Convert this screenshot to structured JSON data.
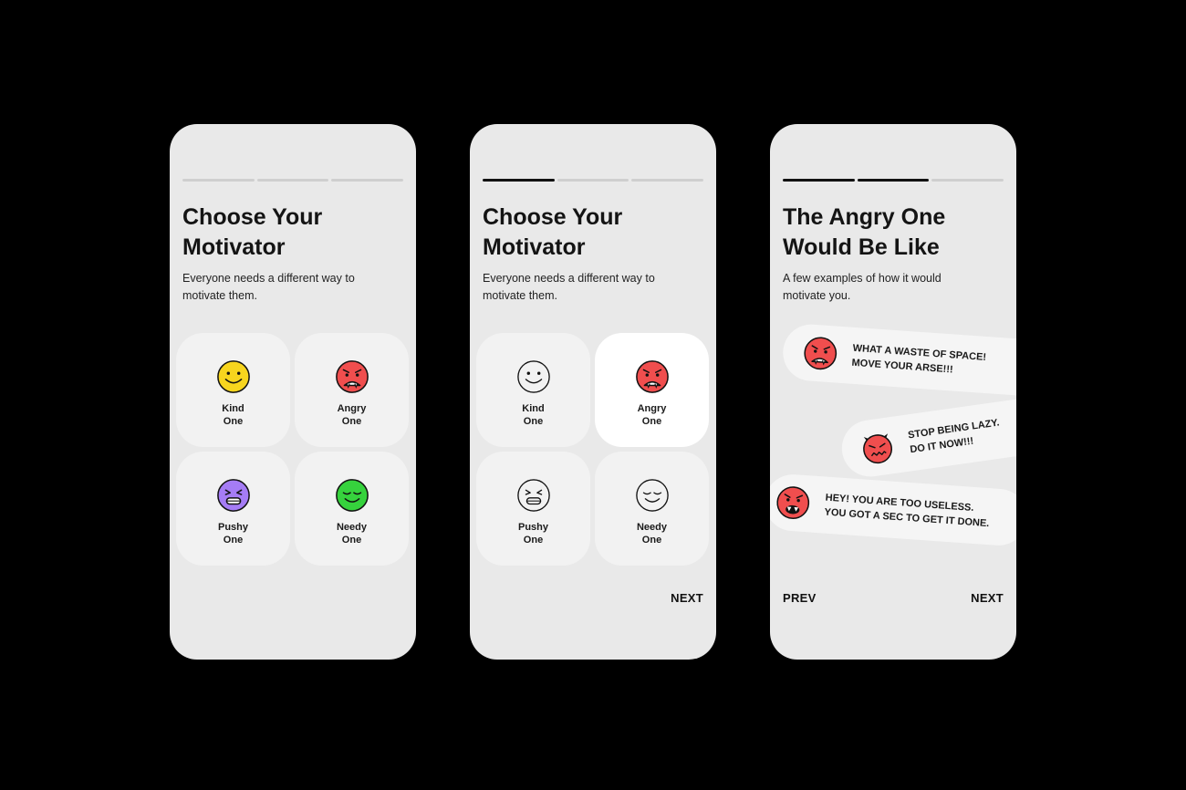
{
  "colors": {
    "kind": "#f7d51e",
    "angry": "#f04e4e",
    "pushy": "#a57cf5",
    "needy": "#36d23d",
    "outline": "#111111"
  },
  "screen1": {
    "title": "Choose Your\nMotivator",
    "subtitle": "Everyone needs a different way to motivate them.",
    "options": [
      {
        "label": "Kind\nOne",
        "icon": "smiling-face-icon"
      },
      {
        "label": "Angry\nOne",
        "icon": "angry-fanged-face-icon"
      },
      {
        "label": "Pushy\nOne",
        "icon": "gritting-face-icon"
      },
      {
        "label": "Needy\nOne",
        "icon": "content-face-icon"
      }
    ]
  },
  "screen2": {
    "title": "Choose Your\nMotivator",
    "subtitle": "Everyone needs a different way to motivate them.",
    "selected": "Angry One",
    "options": [
      {
        "label": "Kind\nOne"
      },
      {
        "label": "Angry\nOne"
      },
      {
        "label": "Pushy\nOne"
      },
      {
        "label": "Needy\nOne"
      }
    ],
    "next_label": "NEXT"
  },
  "screen3": {
    "title": "The Angry One\nWould Be Like",
    "subtitle": "A few examples of how it would motivate you.",
    "messages": [
      {
        "text": "WHAT A WASTE OF SPACE!\nMOVE YOUR ARSE!!!",
        "icon": "angry-fanged-face-icon"
      },
      {
        "text": "STOP BEING LAZY.\nDO IT NOW!!!",
        "icon": "devil-face-icon"
      },
      {
        "text": "HEY! YOU ARE TOO USELESS.\nYOU GOT A SEC TO GET IT DONE.",
        "icon": "screaming-face-icon"
      }
    ],
    "prev_label": "PREV",
    "next_label": "NEXT"
  }
}
